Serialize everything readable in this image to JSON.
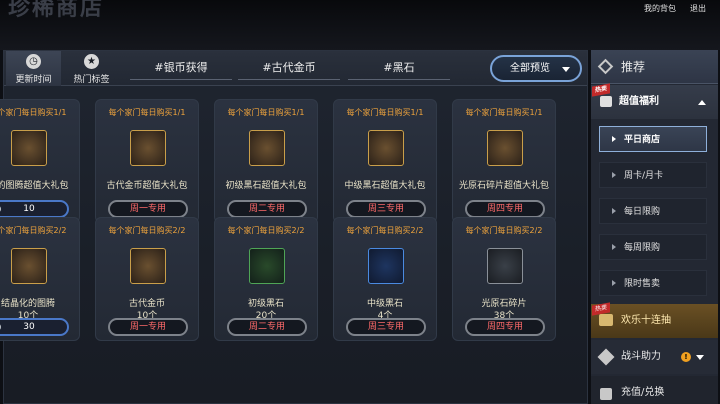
{
  "header": {
    "title": "珍稀商店",
    "bag_label": "我的背包",
    "exit_label": "退出"
  },
  "tabs": {
    "update_time": "更新时间",
    "hot_tags": "热门标签",
    "hashtags": [
      "#银币获得",
      "#古代金币",
      "#黑石"
    ],
    "preview_all": "全部预览"
  },
  "cards": [
    {
      "limit": "每个家门每日购买1/1",
      "name": "化的图腾超值大礼包",
      "button": "10",
      "button_type": "price",
      "icon": "gold-chest-icon",
      "frame": "gold"
    },
    {
      "limit": "每个家门每日购买1/1",
      "name": "古代金币超值大礼包",
      "button": "周一专用",
      "button_type": "day",
      "icon": "gold-chest-icon",
      "frame": "gold"
    },
    {
      "limit": "每个家门每日购买1/1",
      "name": "初级黑石超值大礼包",
      "button": "周二专用",
      "button_type": "day",
      "icon": "green-chest-icon",
      "frame": "gold"
    },
    {
      "limit": "每个家门每日购买1/1",
      "name": "中级黑石超值大礼包",
      "button": "周三专用",
      "button_type": "day",
      "icon": "blue-chest-icon",
      "frame": "gold"
    },
    {
      "limit": "每个家门每日购买1/1",
      "name": "光原石碎片超值大礼包",
      "button": "周四专用",
      "button_type": "day",
      "icon": "purple-chest-icon",
      "frame": "gold"
    },
    {
      "limit": "每个家门每日购买2/2",
      "name": "结晶化的图腾",
      "count": "10个",
      "button": "30",
      "button_type": "price",
      "icon": "crystal-totem-icon",
      "frame": "gold"
    },
    {
      "limit": "每个家门每日购买2/2",
      "name": "古代金币",
      "count": "10个",
      "button": "周一专用",
      "button_type": "day",
      "icon": "gold-coin-icon",
      "frame": "gold"
    },
    {
      "limit": "每个家门每日购买2/2",
      "name": "初级黑石",
      "count": "20个",
      "button": "周二专用",
      "button_type": "day",
      "icon": "black-stone-icon",
      "frame": "green"
    },
    {
      "limit": "每个家门每日购买2/2",
      "name": "中级黑石",
      "count": "4个",
      "button": "周三专用",
      "button_type": "day",
      "icon": "black-stone-icon",
      "frame": "blue"
    },
    {
      "limit": "每个家门每日购买2/2",
      "name": "光原石碎片",
      "count": "38个",
      "button": "周四专用",
      "button_type": "day",
      "icon": "ore-fragment-icon",
      "frame": "gray"
    }
  ],
  "sidebar": {
    "recommend": "推荐",
    "welfare": "超值福利",
    "hot_tag": "热卖",
    "items": [
      {
        "label": "平日商店",
        "active": true
      },
      {
        "label": "周卡/月卡",
        "active": false
      },
      {
        "label": "每日限购",
        "active": false
      },
      {
        "label": "每周限购",
        "active": false
      },
      {
        "label": "限时售卖",
        "active": false
      }
    ],
    "event": "欢乐十连抽",
    "battle": "战斗助力",
    "recharge": "充值/兑换"
  }
}
